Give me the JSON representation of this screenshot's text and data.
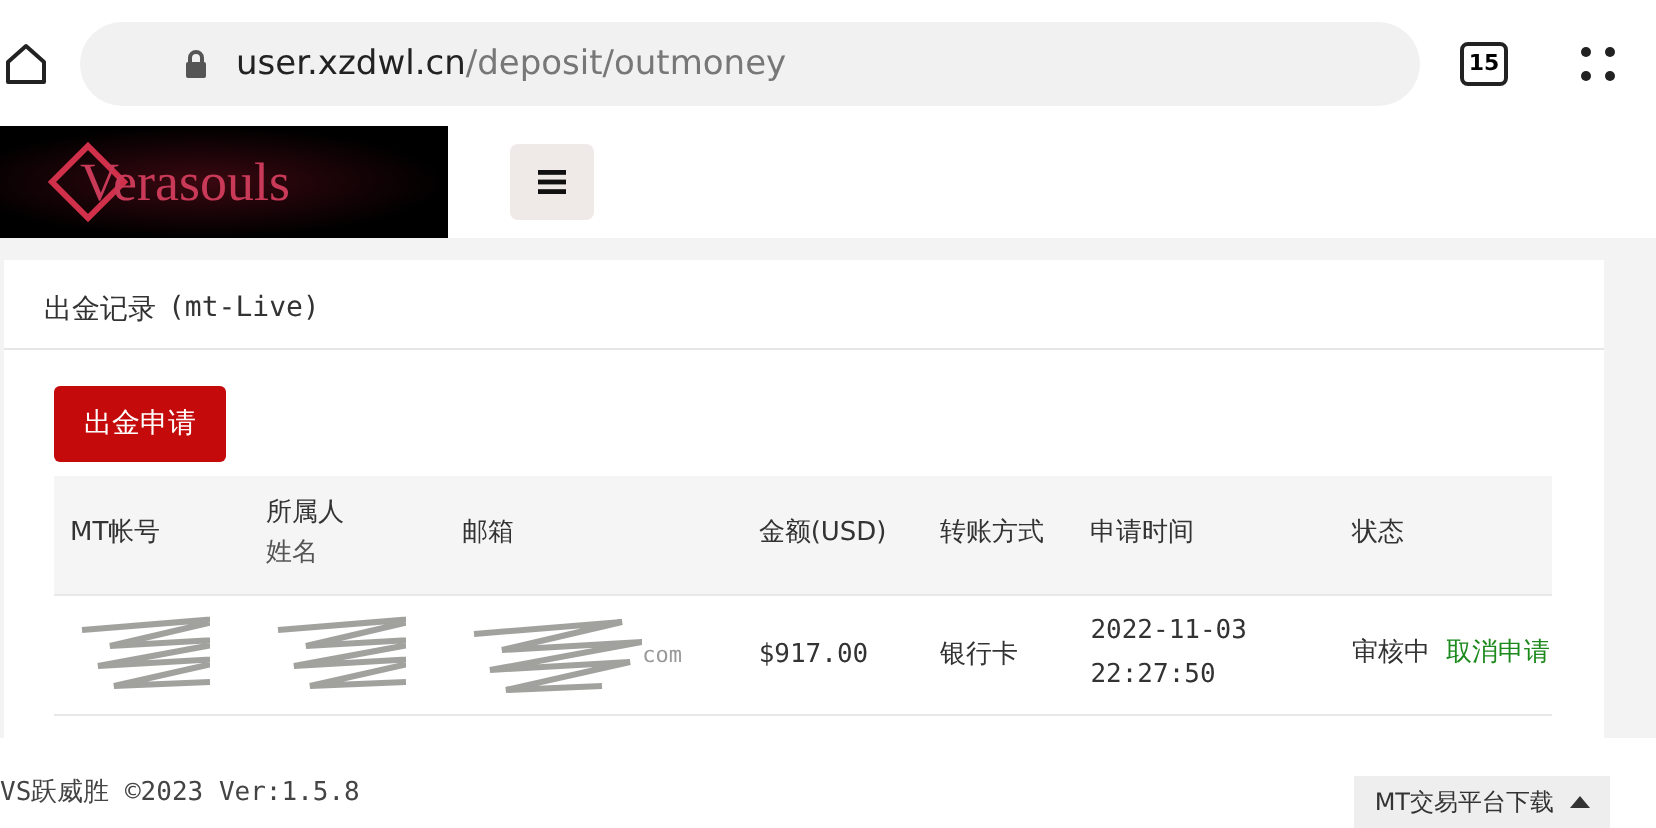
{
  "browser": {
    "url_host": "user.xzdwl.cn",
    "url_path": "/deposit/outmoney",
    "tab_count": "15"
  },
  "header": {
    "logo_text": "Verasouls"
  },
  "card": {
    "title": "出金记录",
    "subtitle": "(mt-Live)",
    "action_button": "出金申请"
  },
  "table": {
    "columns": [
      {
        "label": "MT帐号"
      },
      {
        "label": "所属人",
        "sub": "姓名"
      },
      {
        "label": "邮箱"
      },
      {
        "label": "金额(USD)"
      },
      {
        "label": "转账方式"
      },
      {
        "label": "申请时间"
      },
      {
        "label": "状态"
      }
    ],
    "rows": [
      {
        "email_tail": "com",
        "amount": "$917.00",
        "method": "银行卡",
        "time": "2022-11-03 22:27:50",
        "status": "审核中",
        "action": "取消申请"
      }
    ]
  },
  "footer": {
    "text": "VS跃威胜 ©2023 Ver:1.5.8",
    "download_tab": "MT交易平台下载"
  }
}
